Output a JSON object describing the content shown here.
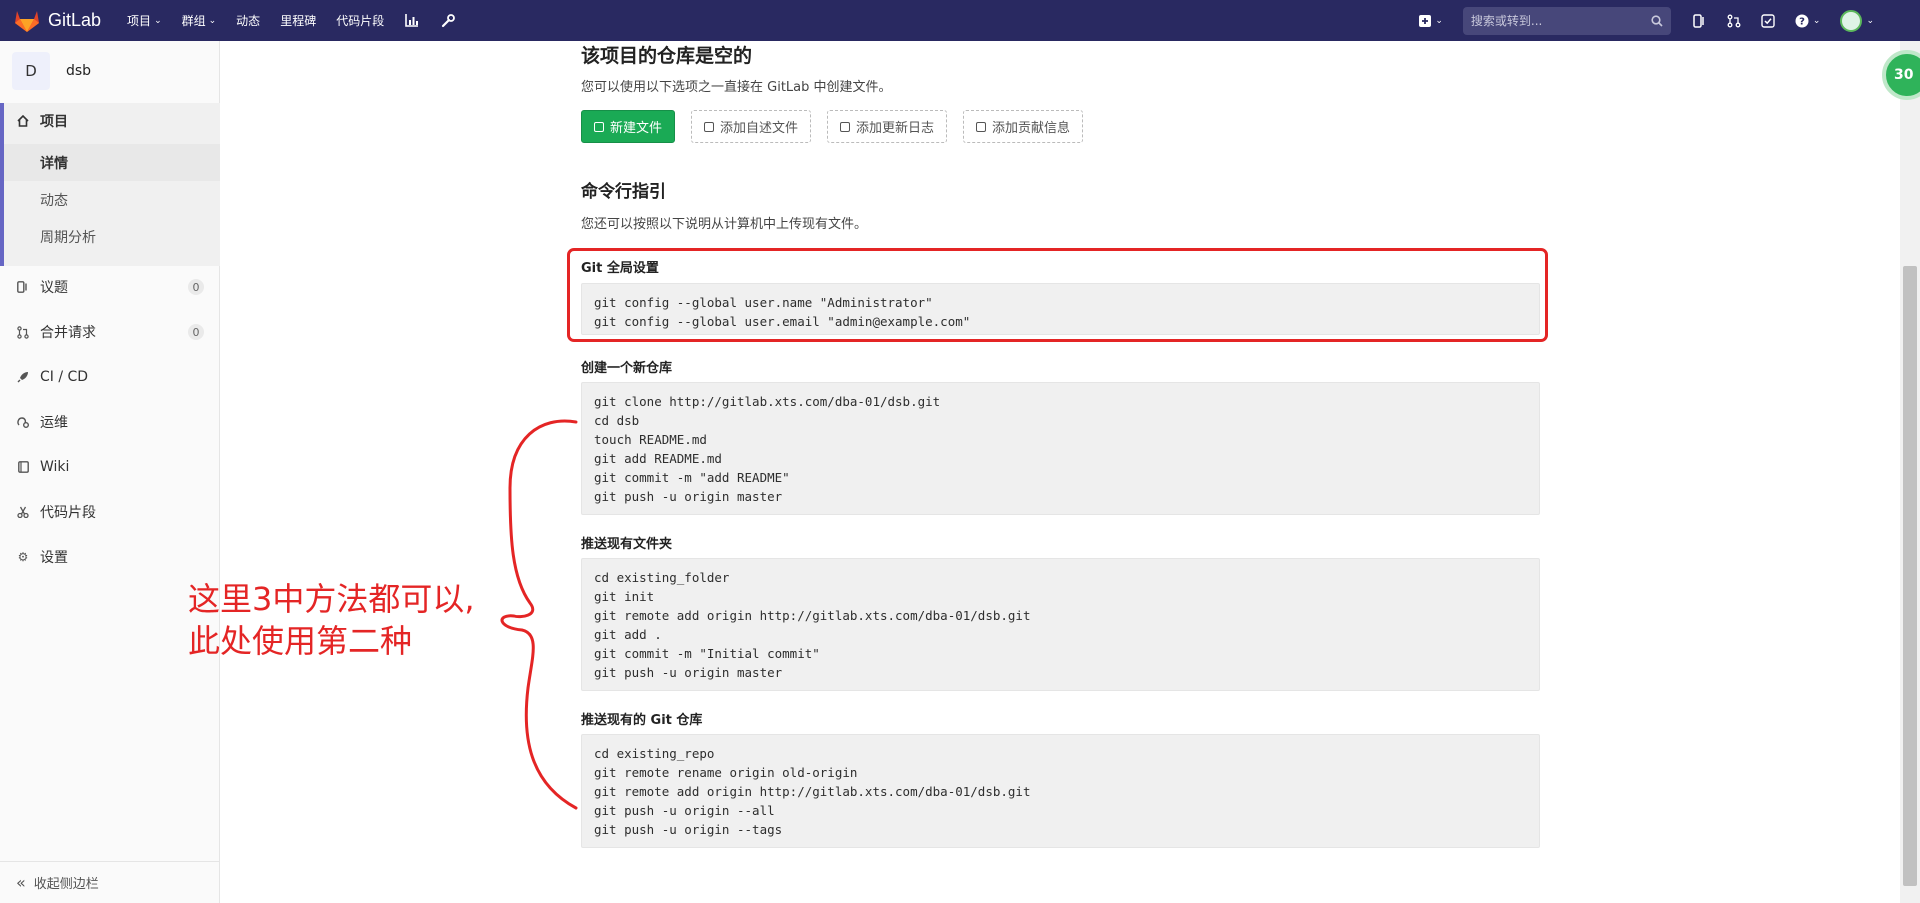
{
  "navbar": {
    "brand": "GitLab",
    "menu": [
      {
        "label": "项目",
        "dropdown": true
      },
      {
        "label": "群组",
        "dropdown": true
      },
      {
        "label": "动态",
        "dropdown": false
      },
      {
        "label": "里程碑",
        "dropdown": false
      },
      {
        "label": "代码片段",
        "dropdown": false
      }
    ],
    "icons": [
      "chart-icon",
      "wrench-icon"
    ],
    "search_placeholder": "搜索或转到...",
    "colors": {
      "bg": "#292961",
      "search_bg": "#47477a"
    }
  },
  "sidebar": {
    "project_initial": "D",
    "project_name": "dsb",
    "active_section": "项目",
    "sub_items": [
      "详情",
      "动态",
      "周期分析"
    ],
    "items": [
      {
        "label": "议题",
        "icon": "issues-icon",
        "count": "0"
      },
      {
        "label": "合并请求",
        "icon": "merge-request-icon",
        "count": "0"
      },
      {
        "label": "CI / CD",
        "icon": "rocket-icon"
      },
      {
        "label": "运维",
        "icon": "operations-icon"
      },
      {
        "label": "Wiki",
        "icon": "book-icon"
      },
      {
        "label": "代码片段",
        "icon": "snippet-icon"
      },
      {
        "label": "设置",
        "icon": "gear-icon"
      }
    ],
    "collapse_label": "收起侧边栏"
  },
  "main": {
    "empty_title": "该项目的仓库是空的",
    "empty_desc": "您可以使用以下选项之一直接在 GitLab 中创建文件。",
    "buttons": [
      "新建文件",
      "添加自述文件",
      "添加更新日志",
      "添加贡献信息"
    ],
    "cli_title": "命令行指引",
    "cli_desc": "您还可以按照以下说明从计算机中上传现有文件。",
    "sections": [
      {
        "title": "Git 全局设置",
        "lines": [
          "git config --global user.name \"Administrator\"",
          "git config --global user.email \"admin@example.com\""
        ]
      },
      {
        "title": "创建一个新仓库",
        "lines": [
          "git clone http://gitlab.xts.com/dba-01/dsb.git",
          "cd dsb",
          "touch README.md",
          "git add README.md",
          "git commit -m \"add README\"",
          "git push -u origin master"
        ]
      },
      {
        "title": "推送现有文件夹",
        "lines": [
          "cd existing_folder",
          "git init",
          "git remote add origin http://gitlab.xts.com/dba-01/dsb.git",
          "git add .",
          "git commit -m \"Initial commit\"",
          "git push -u origin master"
        ]
      },
      {
        "title": "推送现有的 Git 仓库",
        "lines": [
          "cd existing_repo",
          "git remote rename origin old-origin",
          "git remote add origin http://gitlab.xts.com/dba-01/dsb.git",
          "git push -u origin --all",
          "git push -u origin --tags"
        ]
      }
    ]
  },
  "annotation": {
    "line1": "这里3中方法都可以,",
    "line2": "此处使用第二种",
    "color": "#e42525"
  },
  "badge": "30"
}
